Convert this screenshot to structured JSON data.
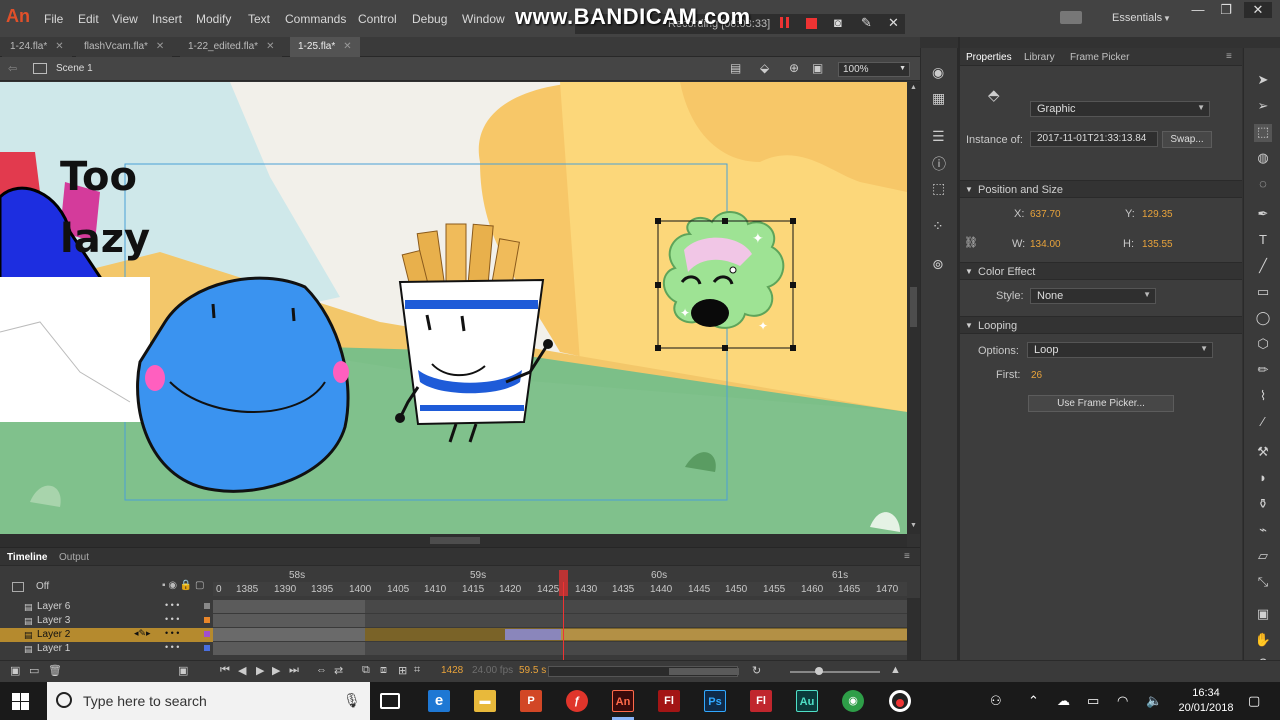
{
  "app": {
    "logo": "An",
    "menu": [
      "File",
      "Edit",
      "View",
      "Insert",
      "Modify",
      "Text",
      "Commands",
      "Control",
      "Debug",
      "Window"
    ],
    "watermark": "www.BANDICAM.com",
    "recording": "Recording [00:03:33]",
    "workspace": "Essentials"
  },
  "tabs": [
    {
      "label": "1-24.fla*"
    },
    {
      "label": "flashVcam.fla*"
    },
    {
      "label": "1-22_edited.fla*"
    },
    {
      "label": "1-25.fla*"
    }
  ],
  "scene": {
    "name": "Scene 1",
    "zoom": "100%"
  },
  "stage": {
    "caption_line1": "Too",
    "caption_line2": "lazy"
  },
  "properties": {
    "tabs": [
      "Properties",
      "Library",
      "Frame Picker"
    ],
    "symbol_type": "Graphic",
    "instance_label": "Instance of:",
    "instance_value": "2017-11-01T21:33:13.84",
    "swap_button": "Swap...",
    "position_section": "Position and Size",
    "x_label": "X:",
    "x_value": "637.70",
    "y_label": "Y:",
    "y_value": "129.35",
    "w_label": "W:",
    "w_value": "134.00",
    "h_label": "H:",
    "h_value": "135.55",
    "color_section": "Color Effect",
    "style_label": "Style:",
    "style_value": "None",
    "looping_section": "Looping",
    "options_label": "Options:",
    "options_value": "Loop",
    "first_label": "First:",
    "first_value": "26",
    "frame_picker_button": "Use Frame Picker..."
  },
  "timeline": {
    "tabs": [
      "Timeline",
      "Output"
    ],
    "onion": "Off",
    "seconds": [
      "58s",
      "59s",
      "60s",
      "61s"
    ],
    "ruler": [
      "0",
      "1385",
      "1390",
      "1395",
      "1400",
      "1405",
      "1410",
      "1415",
      "1420",
      "1425",
      "1430",
      "1435",
      "1440",
      "1445",
      "1450",
      "1455",
      "1460",
      "1465",
      "1470"
    ],
    "layers": [
      {
        "name": "Layer 6",
        "selected": false
      },
      {
        "name": "Layer 3",
        "selected": false
      },
      {
        "name": "Layer 2",
        "selected": true
      },
      {
        "name": "Layer 1",
        "selected": false
      }
    ],
    "current_frame": "1428",
    "fps": "24.00 fps",
    "time": "59.5 s"
  },
  "taskbar": {
    "search_placeholder": "Type here to search",
    "apps": [
      "Task View",
      "Edge",
      "File Explorer",
      "PowerPoint",
      "Flash Player",
      "Animate",
      "Flash",
      "Photoshop",
      "Flash",
      "Audition",
      "Chrome",
      "Bandicam"
    ],
    "time": "16:34",
    "date": "20/01/2018"
  }
}
